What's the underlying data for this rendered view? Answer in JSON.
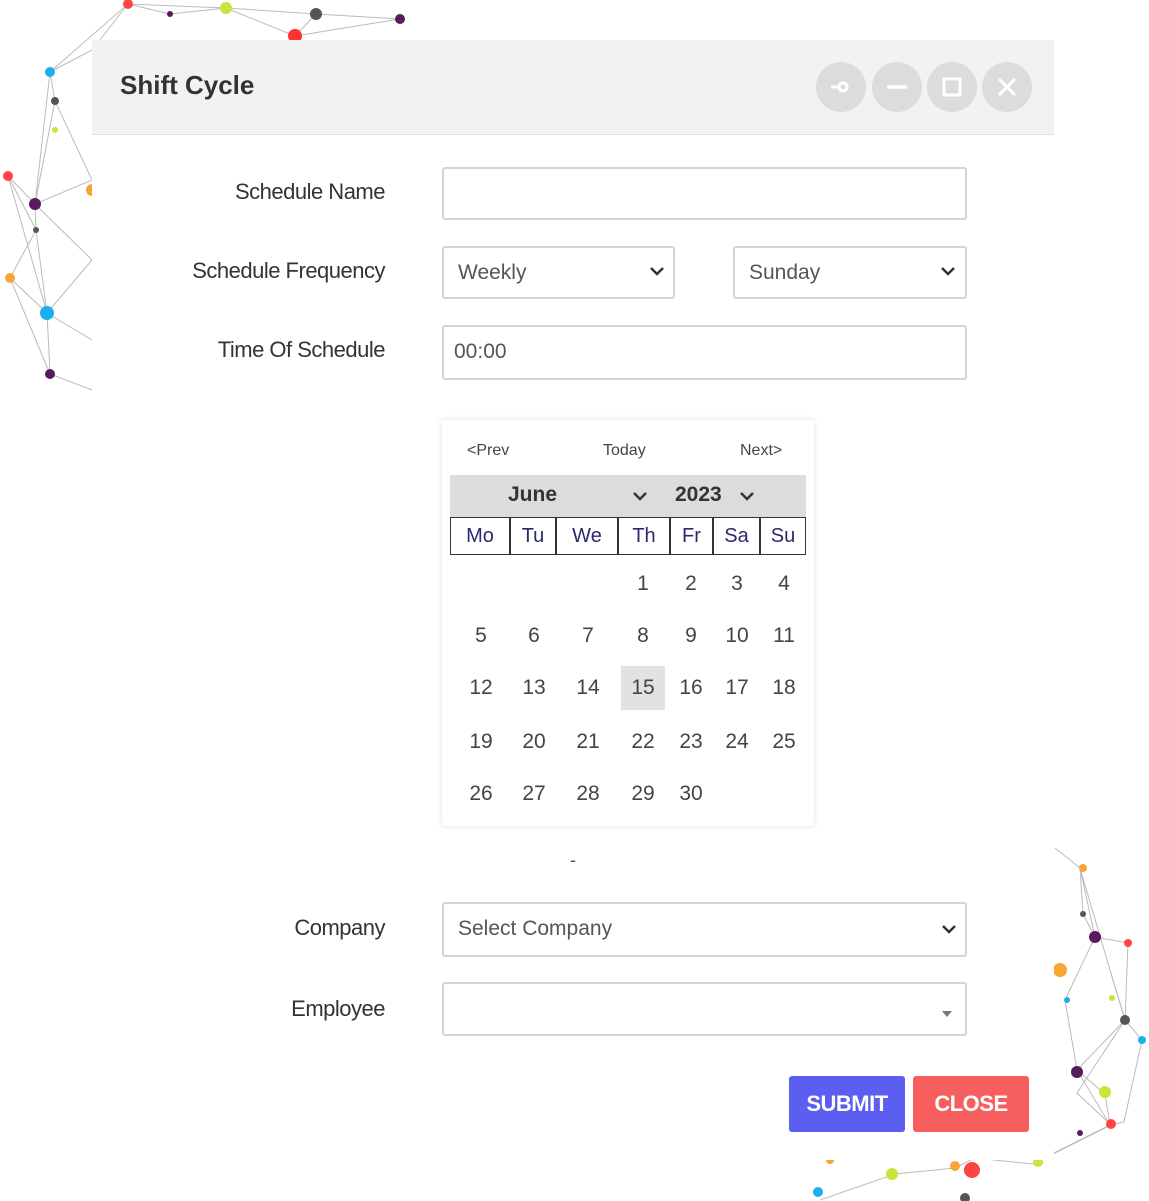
{
  "window": {
    "title": "Shift Cycle",
    "buttons": [
      "pin-icon",
      "minimize-icon",
      "maximize-icon",
      "close-icon"
    ]
  },
  "form": {
    "schedule_name": {
      "label": "Schedule Name",
      "value": ""
    },
    "schedule_frequency": {
      "label": "Schedule Frequency",
      "value": "Weekly",
      "day_value": "Sunday"
    },
    "time_of_schedule": {
      "label": "Time Of Schedule",
      "value": "00:00"
    },
    "company": {
      "label": "Company",
      "value": "Select Company"
    },
    "employee": {
      "label": "Employee",
      "value": ""
    }
  },
  "calendar": {
    "prev": "<Prev",
    "today": "Today",
    "next": "Next>",
    "month": "June",
    "year": "2023",
    "weekdays": [
      "Mo",
      "Tu",
      "We",
      "Th",
      "Fr",
      "Sa",
      "Su"
    ],
    "days": [
      "1",
      "2",
      "3",
      "4",
      "5",
      "6",
      "7",
      "8",
      "9",
      "10",
      "11",
      "12",
      "13",
      "14",
      "15",
      "16",
      "17",
      "18",
      "19",
      "20",
      "21",
      "22",
      "23",
      "24",
      "25",
      "26",
      "27",
      "28",
      "29",
      "30"
    ],
    "selected": "15",
    "first_weekday_index": 3
  },
  "separator": "-",
  "actions": {
    "submit": "SUBMIT",
    "close": "CLOSE"
  },
  "colors": {
    "submit": "#5b5ef0",
    "close": "#f75f5f",
    "titlebar": "#f2f2f2"
  }
}
